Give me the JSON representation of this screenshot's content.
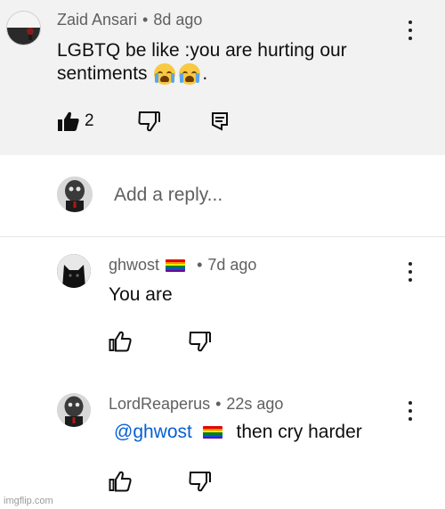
{
  "comment": {
    "author": "Zaid Ansari",
    "age": "8d ago",
    "text_line1": "LGBTQ be like :you are hurting our",
    "text_line2": "sentiments",
    "text_line2_end": ".",
    "emoji_icon": "loudly-crying-face",
    "like_count": "2"
  },
  "reply_box": {
    "placeholder": "Add a reply..."
  },
  "replies": [
    {
      "author": "ghwost",
      "age": "7d ago",
      "text": "You are",
      "flag_icon": "rainbow-flag"
    },
    {
      "author": "LordReaperus",
      "age": "22s ago",
      "mention": "@ghwost",
      "text": "then cry harder"
    }
  ],
  "watermark": "imgflip.com",
  "colors": {
    "top_background": "#f2f2f2",
    "mention": "#065fd4",
    "meta_text": "#606060"
  }
}
